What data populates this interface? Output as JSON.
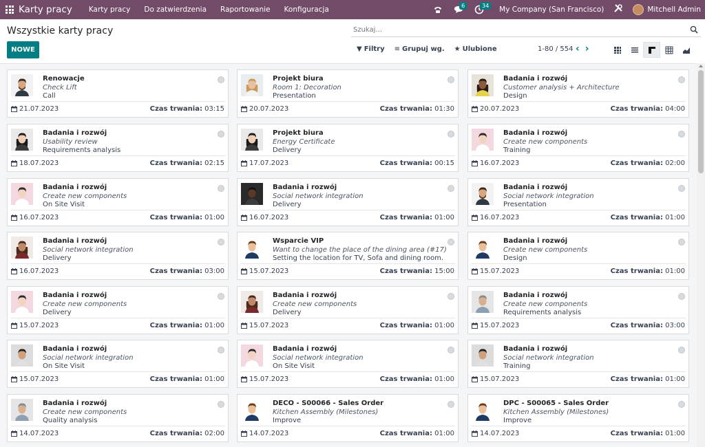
{
  "navbar": {
    "app_title": "Karty pracy",
    "menu": [
      "Karty pracy",
      "Do zatwierdzenia",
      "Raportowanie",
      "Konfiguracja"
    ],
    "messages_count": "6",
    "activities_count": "34",
    "company": "My Company (San Francisco)",
    "user": "Mitchell Admin"
  },
  "page": {
    "title": "Wszystkie karty pracy",
    "new_button": "NOWE",
    "search_placeholder": "Szukaj...",
    "filters_label": "Filtry",
    "groupby_label": "Grupuj wg.",
    "favorites_label": "Ulubione",
    "pager": "1-80 / 554"
  },
  "duration_label": "Czas trwania:",
  "cards": [
    {
      "title": "Renowacje",
      "subtitle": "Check Lift",
      "step": "Call",
      "date": "21.07.2023",
      "duration": "03:15",
      "avatar": "man-beard"
    },
    {
      "title": "Projekt biura",
      "subtitle": "Room 1: Decoration",
      "step": "Presentation",
      "date": "20.07.2023",
      "duration": "01:30",
      "avatar": "woman-blonde"
    },
    {
      "title": "Badania i rozwój",
      "subtitle": "Customer analysis + Architecture",
      "step": "Design",
      "date": "20.07.2023",
      "duration": "04:00",
      "avatar": "woman-curly"
    },
    {
      "title": "Badania i rozwój",
      "subtitle": "Usability review",
      "step": "Requirements analysis",
      "date": "18.07.2023",
      "duration": "02:15",
      "avatar": "woman-dark"
    },
    {
      "title": "Projekt biura",
      "subtitle": "Energy Certificate",
      "step": "Delivery",
      "date": "17.07.2023",
      "duration": "00:15",
      "avatar": "woman-dark"
    },
    {
      "title": "Badania i rozwój",
      "subtitle": "Create new components",
      "step": "Training",
      "date": "16.07.2023",
      "duration": "02:00",
      "avatar": "man-pink"
    },
    {
      "title": "Badania i rozwój",
      "subtitle": "Create new components",
      "step": "On Site Visit",
      "date": "16.07.2023",
      "duration": "01:00",
      "avatar": "man-pink"
    },
    {
      "title": "Badania i rozwój",
      "subtitle": "Social network integration",
      "step": "Delivery",
      "date": "16.07.2023",
      "duration": "01:00",
      "avatar": "man-dark"
    },
    {
      "title": "Badania i rozwój",
      "subtitle": "Social network integration",
      "step": "Presentation",
      "date": "16.07.2023",
      "duration": "01:00",
      "avatar": "man-beard"
    },
    {
      "title": "Badania i rozwój",
      "subtitle": "Social network integration",
      "step": "Delivery",
      "date": "16.07.2023",
      "duration": "03:00",
      "avatar": "woman-curly2"
    },
    {
      "title": "Wsparcie VIP",
      "subtitle": "Want to change the place of the dining area (#17)",
      "step": "Setting the location for TV, Sofa and dining room.",
      "date": "15.07.2023",
      "duration": "15:00",
      "avatar": "man-suit"
    },
    {
      "title": "Badania i rozwój",
      "subtitle": "Create new components",
      "step": "Design",
      "date": "15.07.2023",
      "duration": "01:00",
      "avatar": "man-suit"
    },
    {
      "title": "Badania i rozwój",
      "subtitle": "Create new components",
      "step": "Delivery",
      "date": "15.07.2023",
      "duration": "01:00",
      "avatar": "man-pink"
    },
    {
      "title": "Badania i rozwój",
      "subtitle": "Create new components",
      "step": "Delivery",
      "date": "15.07.2023",
      "duration": "01:00",
      "avatar": "woman-curly2"
    },
    {
      "title": "Badania i rozwój",
      "subtitle": "Create new components",
      "step": "Requirements analysis",
      "date": "15.07.2023",
      "duration": "03:00",
      "avatar": "man-gray"
    },
    {
      "title": "Badania i rozwój",
      "subtitle": "Social network integration",
      "step": "On Site Visit",
      "date": "15.07.2023",
      "duration": "01:00",
      "avatar": "man-asian"
    },
    {
      "title": "Badania i rozwój",
      "subtitle": "Social network integration",
      "step": "On Site Visit",
      "date": "15.07.2023",
      "duration": "01:00",
      "avatar": "man-pink"
    },
    {
      "title": "Badania i rozwój",
      "subtitle": "Social network integration",
      "step": "Training",
      "date": "15.07.2023",
      "duration": "01:00",
      "avatar": "man-asian"
    },
    {
      "title": "Badania i rozwój",
      "subtitle": "Create new components",
      "step": "Quality analysis",
      "date": "14.07.2023",
      "duration": "02:00",
      "avatar": "man-gray"
    },
    {
      "title": "DECO - S00066 - Sales Order",
      "subtitle": "Kitchen Assembly (Milestones)",
      "step": "Improve",
      "date": "14.07.2023",
      "duration": "01:00",
      "avatar": "man-suit"
    },
    {
      "title": "DPC - S00065 - Sales Order",
      "subtitle": "Kitchen Assembly (Milestones)",
      "step": "Improve",
      "date": "14.07.2023",
      "duration": "01:00",
      "avatar": "man-suit"
    }
  ]
}
